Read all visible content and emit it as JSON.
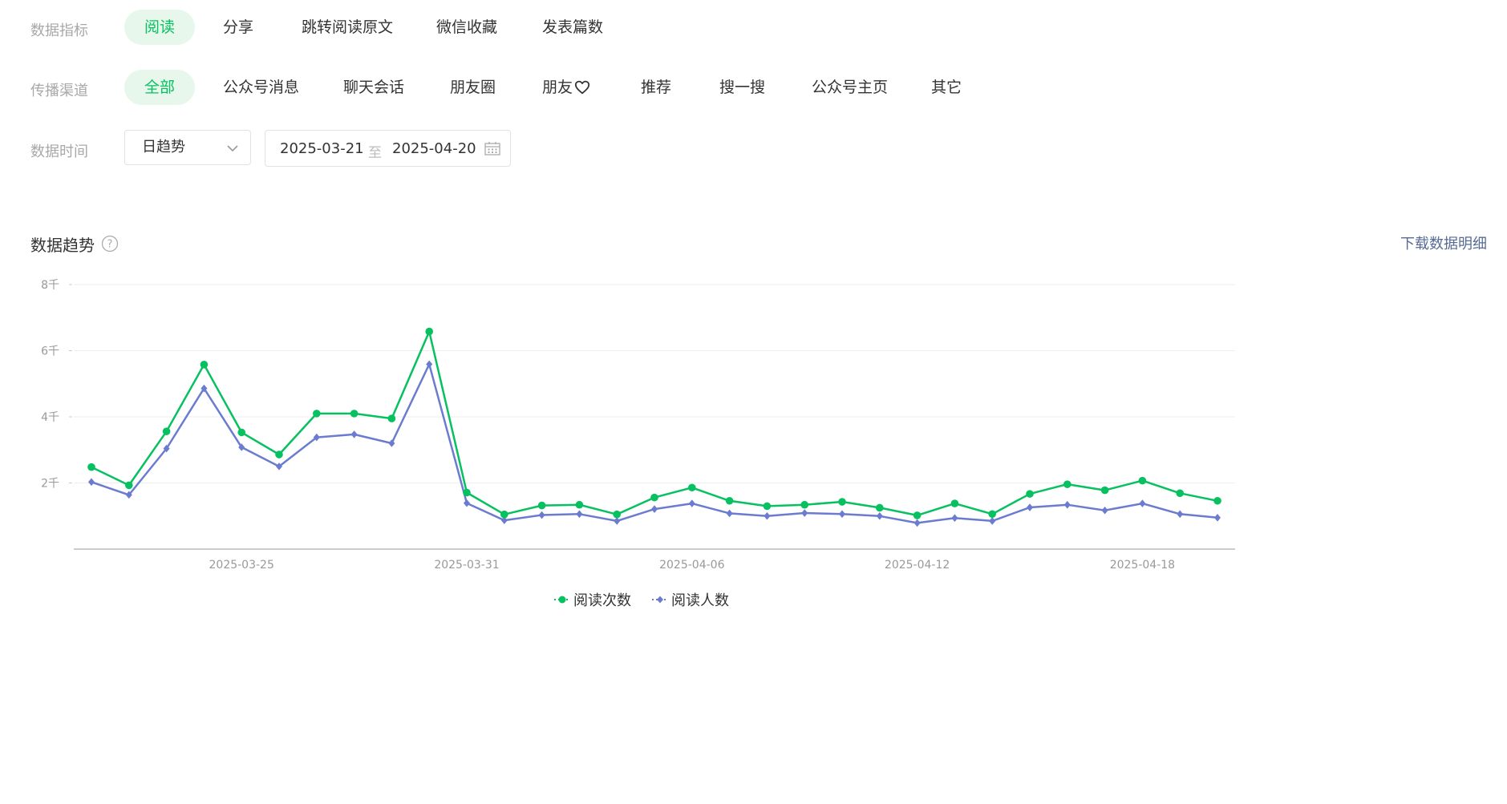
{
  "filters": {
    "metric": {
      "label": "数据指标",
      "options": [
        "阅读",
        "分享",
        "跳转阅读原文",
        "微信收藏",
        "发表篇数"
      ],
      "selected": "阅读"
    },
    "channel": {
      "label": "传播渠道",
      "options": [
        "全部",
        "公众号消息",
        "聊天会话",
        "朋友圈",
        "朋友",
        "推荐",
        "搜一搜",
        "公众号主页",
        "其它"
      ],
      "selected": "全部"
    },
    "time": {
      "label": "数据时间",
      "granularity": "日趋势",
      "start": "2025-03-21",
      "separator": "至",
      "end": "2025-04-20"
    }
  },
  "section": {
    "title": "数据趋势",
    "download_label": "下载数据明细"
  },
  "colors": {
    "accent": "#07c160",
    "series2": "#6b7bd0",
    "link": "#576b95"
  },
  "chart_data": {
    "type": "line",
    "y_ticks": [
      {
        "value": 2000,
        "label": "2千"
      },
      {
        "value": 4000,
        "label": "4千"
      },
      {
        "value": 6000,
        "label": "6千"
      },
      {
        "value": 8000,
        "label": "8千"
      }
    ],
    "ylim": [
      0,
      8000
    ],
    "x": [
      "2025-03-21",
      "2025-03-22",
      "2025-03-23",
      "2025-03-24",
      "2025-03-25",
      "2025-03-26",
      "2025-03-27",
      "2025-03-28",
      "2025-03-29",
      "2025-03-30",
      "2025-03-31",
      "2025-04-01",
      "2025-04-02",
      "2025-04-03",
      "2025-04-04",
      "2025-04-05",
      "2025-04-06",
      "2025-04-07",
      "2025-04-08",
      "2025-04-09",
      "2025-04-10",
      "2025-04-11",
      "2025-04-12",
      "2025-04-13",
      "2025-04-14",
      "2025-04-15",
      "2025-04-16",
      "2025-04-17",
      "2025-04-18",
      "2025-04-19",
      "2025-04-20"
    ],
    "x_tick_labels": [
      "2025-03-25",
      "2025-03-31",
      "2025-04-06",
      "2025-04-12",
      "2025-04-18"
    ],
    "grid": true,
    "legend_position": "bottom-center",
    "series": [
      {
        "name": "阅读次数",
        "color": "#07c160",
        "marker": "circle",
        "values": [
          2480,
          1930,
          3560,
          5580,
          3530,
          2860,
          4100,
          4100,
          3950,
          6580,
          1710,
          1050,
          1320,
          1340,
          1050,
          1560,
          1860,
          1460,
          1300,
          1340,
          1430,
          1250,
          1020,
          1380,
          1060,
          1670,
          1960,
          1780,
          2070,
          1690,
          1460
        ]
      },
      {
        "name": "阅读人数",
        "color": "#6b7bd0",
        "marker": "diamond",
        "values": [
          2030,
          1640,
          3040,
          4860,
          3080,
          2500,
          3380,
          3470,
          3200,
          5590,
          1390,
          870,
          1030,
          1060,
          850,
          1210,
          1380,
          1080,
          1000,
          1090,
          1060,
          1000,
          790,
          940,
          850,
          1260,
          1340,
          1170,
          1380,
          1060,
          950
        ]
      }
    ]
  }
}
